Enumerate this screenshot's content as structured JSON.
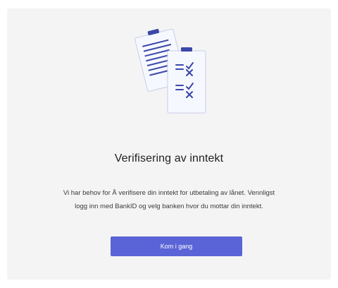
{
  "dialog": {
    "title": "Verifisering av inntekt",
    "description_line1": "Vi har behov for Å verifisere din inntekt for utbetaling av lånet. Vennligst",
    "description_line2": "logg inn med BankID og velg banken hvor du mottar din inntekt.",
    "start_button_label": "Kom i gang",
    "illustration_icon": "documents-checklist-icon"
  },
  "colors": {
    "accent": "#5b64d6",
    "card_background": "#f4f4f5",
    "clip_color": "#3b48a8",
    "paper_color": "#f6f8ff",
    "line_color": "#3b48a8"
  }
}
